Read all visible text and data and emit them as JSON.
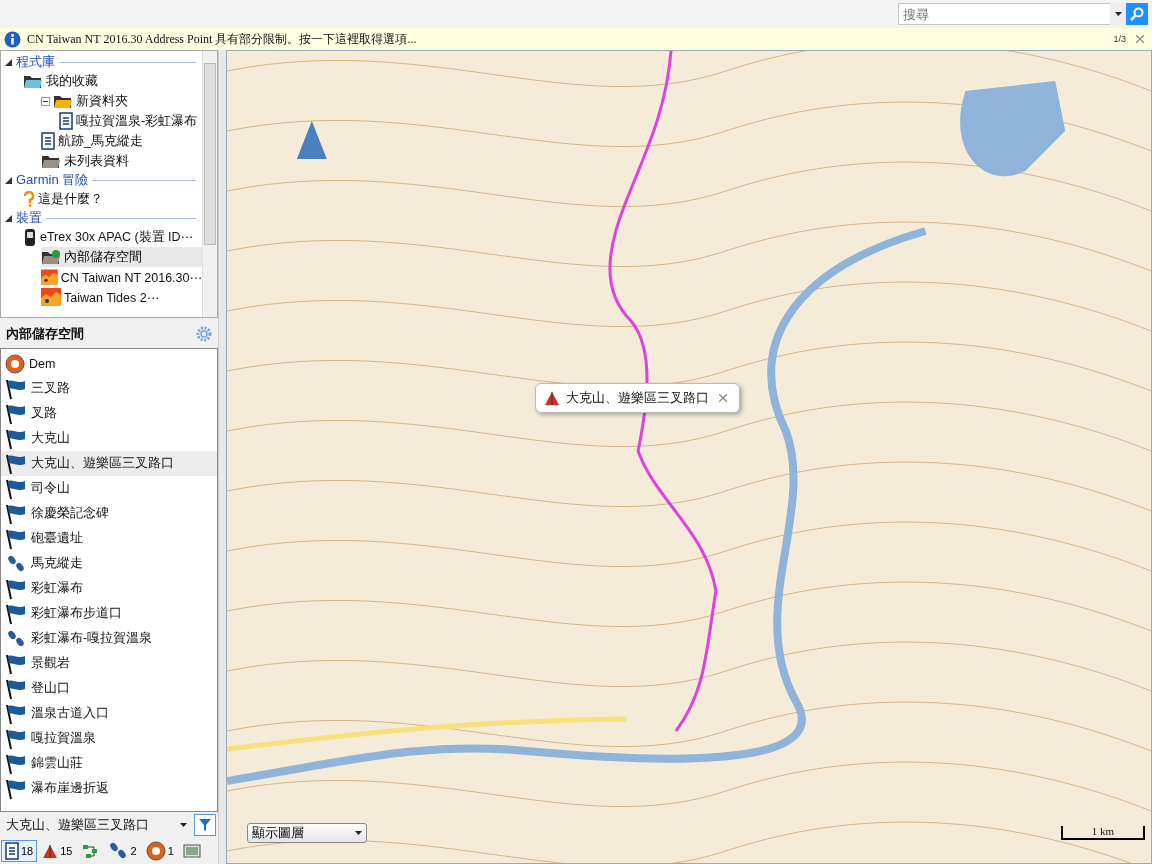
{
  "search": {
    "placeholder": "搜尋"
  },
  "info_bar": {
    "message": "CN Taiwan NT 2016.30 Address Point 具有部分限制。按一下這裡取得選項...",
    "page": "1/3"
  },
  "library": [
    {
      "title": "程式庫",
      "expanded": true,
      "items": [
        {
          "label": "我的收藏",
          "kind": "folder",
          "selected": false,
          "children": [
            {
              "label": "新資料夾",
              "kind": "openfolder",
              "selected": false,
              "expanded": true,
              "children": [
                {
                  "label": "嘎拉賀溫泉-彩虹瀑布",
                  "kind": "list",
                  "selected": false
                }
              ]
            },
            {
              "label": "航跡_馬克縱走",
              "kind": "list",
              "selected": false
            },
            {
              "label": "未列表資料",
              "kind": "graydfolder",
              "selected": false
            }
          ]
        }
      ]
    },
    {
      "title": "Garmin 冒險",
      "expanded": true,
      "items": [
        {
          "label": "這是什麼？",
          "kind": "help",
          "selected": false
        }
      ]
    },
    {
      "title": "裝置",
      "expanded": true,
      "items": [
        {
          "label": "eTrex 30x APAC (裝置 ID⋯",
          "kind": "device",
          "selected": false,
          "children": [
            {
              "label": "內部儲存空間",
              "kind": "storage",
              "selected": true
            },
            {
              "label": "CN Taiwan NT 2016.30⋯",
              "kind": "map",
              "selected": false
            },
            {
              "label": "Taiwan Tides 2⋯",
              "kind": "map",
              "selected": false
            }
          ]
        }
      ]
    }
  ],
  "storage": {
    "title": "內部儲存空間",
    "items": [
      {
        "label": "Dem",
        "kind": "dem",
        "selected": false
      },
      {
        "label": "三叉路",
        "kind": "waypoint",
        "selected": false
      },
      {
        "label": "叉路",
        "kind": "waypoint",
        "selected": false
      },
      {
        "label": "大克山",
        "kind": "waypoint",
        "selected": false
      },
      {
        "label": "大克山、遊樂區三叉路口",
        "kind": "waypoint",
        "selected": true
      },
      {
        "label": "司令山",
        "kind": "waypoint",
        "selected": false
      },
      {
        "label": "徐慶榮記念碑",
        "kind": "waypoint",
        "selected": false
      },
      {
        "label": "砲臺遺址",
        "kind": "waypoint",
        "selected": false
      },
      {
        "label": "馬克縱走",
        "kind": "track",
        "selected": false
      },
      {
        "label": "彩虹瀑布",
        "kind": "waypoint",
        "selected": false
      },
      {
        "label": "彩虹瀑布步道口",
        "kind": "waypoint",
        "selected": false
      },
      {
        "label": "彩虹瀑布-嘎拉賀溫泉",
        "kind": "track",
        "selected": false
      },
      {
        "label": "景觀岩",
        "kind": "waypoint",
        "selected": false
      },
      {
        "label": "登山口",
        "kind": "waypoint",
        "selected": false
      },
      {
        "label": "溫泉古道入口",
        "kind": "waypoint",
        "selected": false
      },
      {
        "label": "嘎拉賀溫泉",
        "kind": "waypoint",
        "selected": false
      },
      {
        "label": "錦雲山莊",
        "kind": "waypoint",
        "selected": false
      },
      {
        "label": "瀑布崖邊折返",
        "kind": "waypoint",
        "selected": false
      }
    ],
    "dropdown": "大克山、遊樂區三叉路口",
    "tabs": [
      {
        "kind": "list",
        "count": "18",
        "selected": true
      },
      {
        "kind": "geocache",
        "count": "15",
        "selected": false
      },
      {
        "kind": "route",
        "selected": false
      },
      {
        "kind": "track",
        "count": "2",
        "selected": false
      },
      {
        "kind": "dem",
        "count": "1",
        "selected": false
      },
      {
        "kind": "photo",
        "selected": false
      }
    ]
  },
  "map": {
    "popup": "大克山、遊樂區三叉路口",
    "layers": "顯示圖層",
    "scale": "1 km"
  }
}
